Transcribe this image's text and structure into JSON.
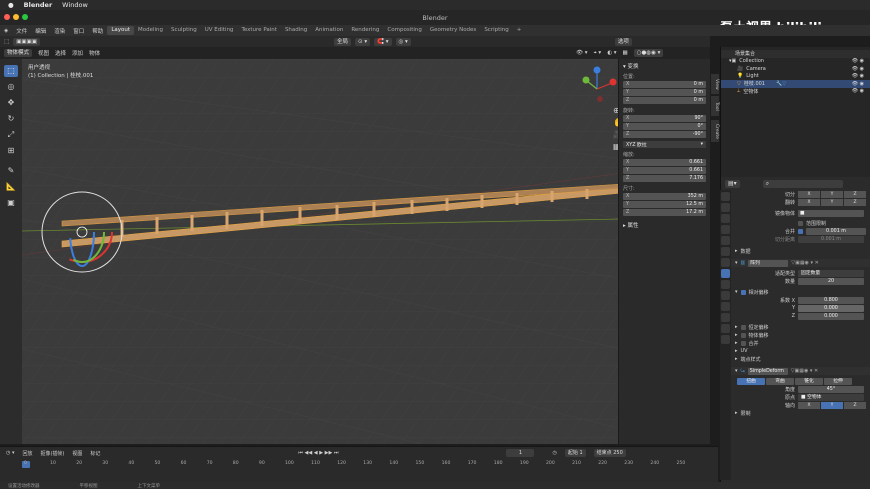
{
  "mac_menu": {
    "apple": "",
    "app": "Blender",
    "window": "Window"
  },
  "window_title": "Blender",
  "blender_menu": [
    "文件",
    "编辑",
    "渲染",
    "窗口",
    "帮助"
  ],
  "workspaces": [
    "Layout",
    "Modeling",
    "Sculpting",
    "UV Editing",
    "Texture Paint",
    "Shading",
    "Animation",
    "Rendering",
    "Compositing",
    "Geometry Nodes",
    "Scripting"
  ],
  "active_workspace": "Layout",
  "vp_header": {
    "mode": "物体模式",
    "menus": [
      "视图",
      "选择",
      "添加",
      "物体"
    ],
    "orientation": "全局",
    "options": "选项"
  },
  "viewport": {
    "view_name": "用户透视",
    "collection_label": "(1) Collection | 桂枝.001"
  },
  "npanel": {
    "transform_title": "变换",
    "location_label": "位置:",
    "location": [
      {
        "ax": "X",
        "v": "0 m"
      },
      {
        "ax": "Y",
        "v": "0 m"
      },
      {
        "ax": "Z",
        "v": "0 m"
      }
    ],
    "rotation_label": "旋转:",
    "rotation": [
      {
        "ax": "X",
        "v": "90°"
      },
      {
        "ax": "Y",
        "v": "0°"
      },
      {
        "ax": "Z",
        "v": "-90°"
      }
    ],
    "rotation_mode": "XYZ 欧拉",
    "scale_label": "缩放:",
    "scale": [
      {
        "ax": "X",
        "v": "0.661"
      },
      {
        "ax": "Y",
        "v": "0.661"
      },
      {
        "ax": "Z",
        "v": "7.176"
      }
    ],
    "dims_label": "尺寸:",
    "dims": [
      {
        "ax": "X",
        "v": "352 m"
      },
      {
        "ax": "Y",
        "v": "12.5 m"
      },
      {
        "ax": "Z",
        "v": "17.2 m"
      }
    ],
    "props_title": "属性",
    "tabs": [
      "Create",
      "Tool",
      "View"
    ]
  },
  "outliner": {
    "header": "场景集合",
    "rows": [
      "Collection",
      "Camera",
      "Light",
      "桂枝.001",
      "空物体"
    ]
  },
  "watermark": "磊土视界 bilibili",
  "props": {
    "axis_label": "切分",
    "axis2_label": "翻转",
    "mirror_object_label": "镜像物体",
    "clipping_label": "范围限制",
    "merge_label": "合并",
    "merge_value": "0.001 m",
    "bisect_label": "切分距离",
    "bisect_value": "0.001 m",
    "data_label": "数据",
    "array_name": "阵列",
    "fit_type_label": "适配类型",
    "fit_type_value": "固定数量",
    "count_label": "数量",
    "count_value": "20",
    "relative_offset_label": "相对偏移",
    "factor_label": "系数 X",
    "factor_x": "0.800",
    "factor_y": "0.000",
    "factor_z": "0.000",
    "const_offset": "恒定偏移",
    "obj_offset": "物体偏移",
    "merge2": "合并",
    "uv": "UV",
    "caps": "端点样式",
    "deform_name": "SimpleDeform",
    "deform_modes": [
      "扭曲",
      "弯曲",
      "锥化",
      "拉伸"
    ],
    "angle_label": "角度",
    "angle_value": "45°",
    "origin_label": "原点",
    "origin_value": "空物体",
    "axis_label2": "轴向",
    "limits_label": "限制",
    "xyz": [
      "X",
      "Y",
      "Z"
    ]
  },
  "timeline": {
    "menus": [
      "回放",
      "抠像(插帧)",
      "视图",
      "标记"
    ],
    "current": "1",
    "start_label": "起始",
    "start": "1",
    "end_label": "结束点",
    "end": "250",
    "ticks": [
      "0",
      "10",
      "20",
      "30",
      "40",
      "50",
      "60",
      "70",
      "80",
      "90",
      "100",
      "110",
      "120",
      "130",
      "140",
      "150",
      "160",
      "170",
      "180",
      "190",
      "200",
      "210",
      "220",
      "230",
      "240",
      "250"
    ]
  },
  "status": [
    "设置活动修改器",
    "平移视图",
    "上下文菜单"
  ],
  "colors": {
    "accent": "#4772b3",
    "bg": "#3b3b3b",
    "ladder": "#c89865"
  }
}
